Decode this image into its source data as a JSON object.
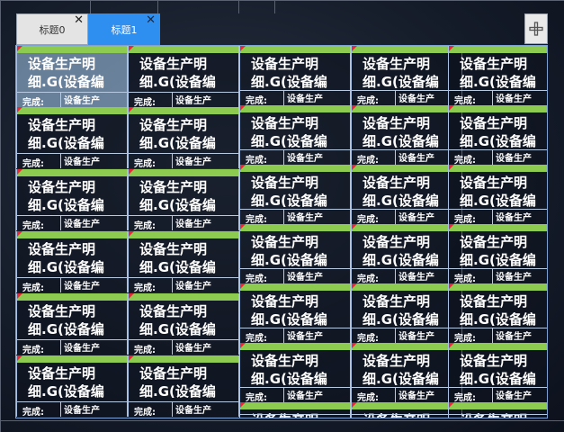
{
  "tabs": [
    {
      "label": "标题0",
      "close": "✕",
      "active": false
    },
    {
      "label": "标题1",
      "close": "✕",
      "active": true
    }
  ],
  "add_button_icon": "plus-icon",
  "card": {
    "title_line1": "设备生产明",
    "title_line2": "细.G(设备编",
    "status_label": "完成:",
    "device_label": "设备生产"
  },
  "colors": {
    "active_tab": "#2f8ff0",
    "header_bar": "#8ccb50",
    "marker": "#e62a3a",
    "border": "#7fa2d6"
  }
}
